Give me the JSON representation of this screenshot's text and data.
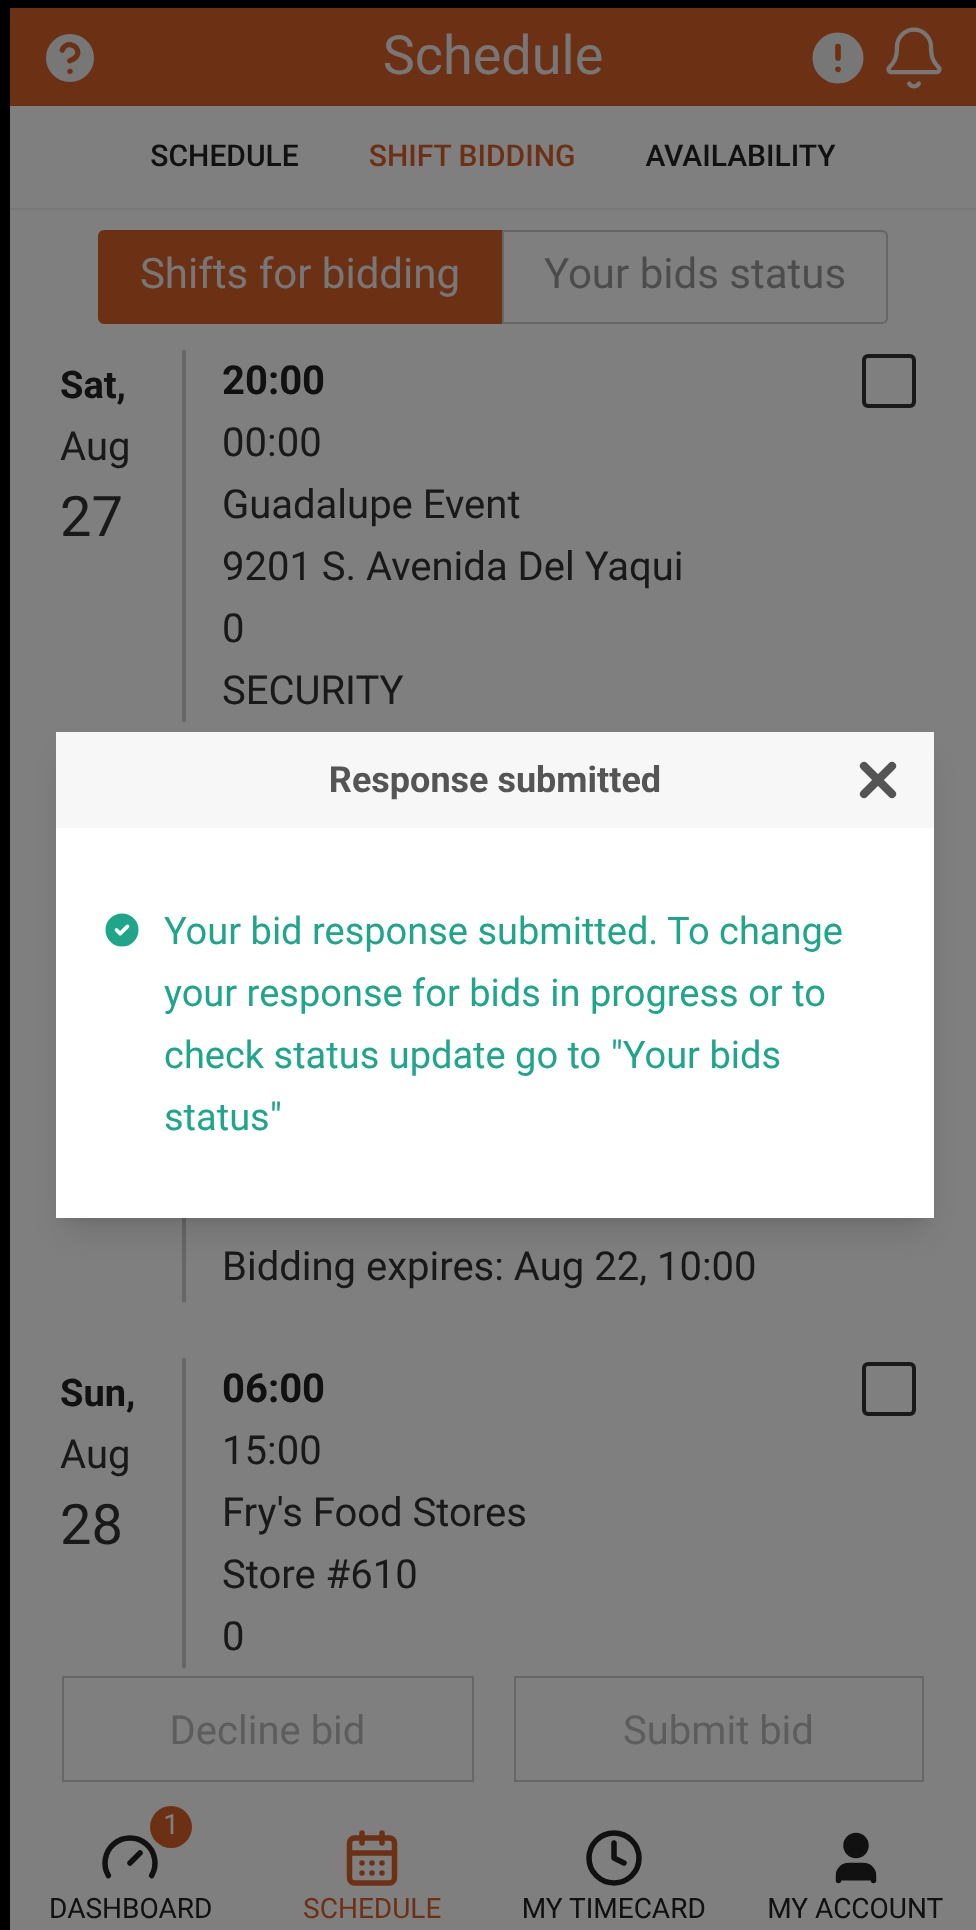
{
  "header": {
    "title": "Schedule"
  },
  "tabs": [
    {
      "label": "SCHEDULE",
      "selected": false
    },
    {
      "label": "SHIFT BIDDING",
      "selected": true
    },
    {
      "label": "AVAILABILITY",
      "selected": false
    }
  ],
  "segments": [
    {
      "label": "Shifts for bidding",
      "selected": true
    },
    {
      "label": "Your bids status",
      "selected": false
    }
  ],
  "shifts": [
    {
      "weekday": "Sat,",
      "month": "Aug",
      "day": "27",
      "lines": [
        "20:00",
        "00:00",
        "Guadalupe Event",
        "9201 S. Avenida Del Yaqui",
        "0",
        "SECURITY"
      ],
      "checked": false
    },
    {
      "lines": [
        "Bidding expires:  Aug 22, 10:00"
      ]
    },
    {
      "weekday": "Sun,",
      "month": "Aug",
      "day": "28",
      "lines": [
        "06:00",
        "15:00",
        "Fry's Food Stores",
        "Store #610",
        "0"
      ],
      "checked": false
    }
  ],
  "buttons": [
    {
      "label": "Decline bid",
      "disabled": true
    },
    {
      "label": "Submit bid",
      "disabled": true
    }
  ],
  "nav": [
    {
      "label": "DASHBOARD",
      "kind": "dashboard",
      "badge": "1",
      "selected": false
    },
    {
      "label": "SCHEDULE",
      "kind": "calendar",
      "selected": true
    },
    {
      "label": "MY TIMECARD",
      "kind": "clock",
      "selected": false
    },
    {
      "label": "MY ACCOUNT",
      "kind": "user",
      "selected": false
    }
  ],
  "modal": {
    "title": "Response submitted",
    "message": "Your bid response submitted. To change your response for bids in progress or to check status update go to \"Your bids status\""
  }
}
